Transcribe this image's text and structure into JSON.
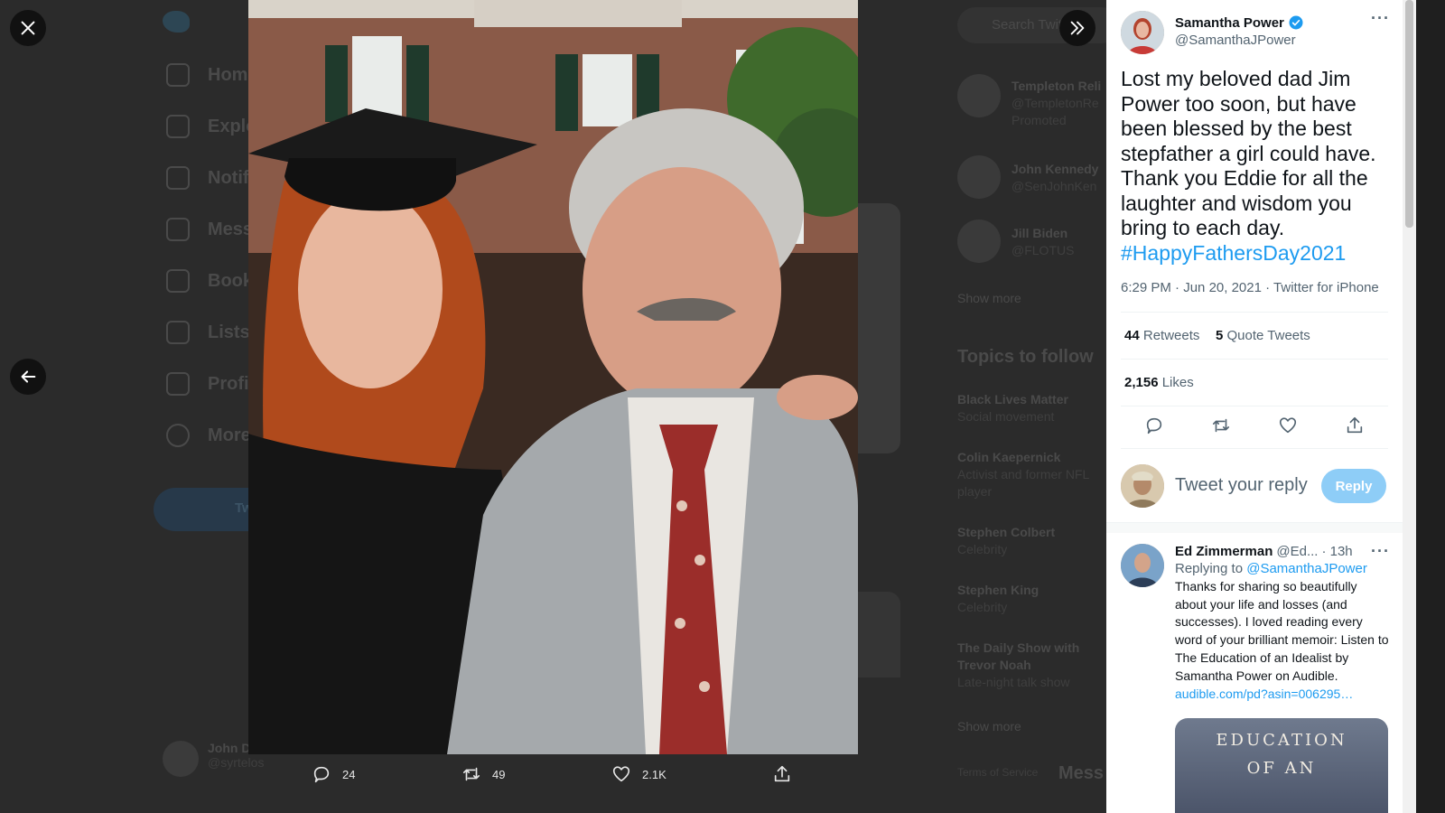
{
  "background": {
    "nav": [
      "Home",
      "Explore",
      "Notifications",
      "Messages",
      "Bookmarks",
      "Lists",
      "Profile",
      "More"
    ],
    "search_placeholder": "Search Twitter",
    "who_to_follow": [
      {
        "name": "Templeton Reli",
        "handle": "@TempletonRe",
        "note": "Promoted"
      },
      {
        "name": "John Kennedy",
        "handle": "@SenJohnKen",
        "note": ""
      },
      {
        "name": "Jill Biden",
        "handle": "@FLOTUS",
        "note": ""
      }
    ],
    "show_more": "Show more",
    "topics_title": "Topics to follow",
    "topics": [
      {
        "name": "Black Lives Matter",
        "sub": "Social movement"
      },
      {
        "name": "Colin Kaepernick",
        "sub": "Activist and former NFL player"
      },
      {
        "name": "Stephen Colbert",
        "sub": "Celebrity"
      },
      {
        "name": "Stephen King",
        "sub": "Celebrity"
      },
      {
        "name": "The Daily Show with Trevor Noah",
        "sub": "Late-night talk show"
      }
    ],
    "bottom_user": {
      "name": "John D",
      "handle": "@syrtelos"
    },
    "footer": "Terms of Service",
    "messages_label": "Mess",
    "tweet_button": "Tw"
  },
  "media_actions": {
    "replies": "24",
    "retweets": "49",
    "likes": "2.1K"
  },
  "tweet": {
    "author_name": "Samantha Power",
    "author_handle": "@SamanthaJPower",
    "verified": true,
    "text": "Lost my beloved dad Jim Power too soon, but have been blessed by the best stepfather a girl could have. Thank you Eddie for all the laughter and wisdom you bring to each day.",
    "hashtag": "#HappyFathersDay2021",
    "time": "6:29 PM",
    "date": "Jun 20, 2021",
    "source": "Twitter for iPhone",
    "retweets_count": "44",
    "retweets_label": "Retweets",
    "quote_count": "5",
    "quote_label": "Quote Tweets",
    "likes_count": "2,156",
    "likes_label": "Likes"
  },
  "reply_box": {
    "placeholder": "Tweet your reply",
    "button": "Reply"
  },
  "reply": {
    "name": "Ed Zimmerman",
    "handle": "@Ed...",
    "time": "· 13h",
    "replying_to_label": "Replying to",
    "replying_to": "@SamanthaJPower",
    "text": "Thanks for sharing so beautifully about your life and losses (and successes). I loved reading every word of your brilliant memoir: Listen to The Education of an Idealist by Samantha Power on Audible.",
    "link": "audible.com/pd?asin=006295…",
    "card_line1": "EDUCATION",
    "card_line2": "OF AN"
  },
  "colors": {
    "accent": "#1d9bf0",
    "overlay_bg": "#1f1f1f",
    "reply_button": "#8ecdf7"
  },
  "icons": [
    "close-icon",
    "expand-icon",
    "back-arrow-icon",
    "reply-icon",
    "retweet-icon",
    "like-icon",
    "share-icon",
    "verified-icon",
    "more-icon"
  ]
}
